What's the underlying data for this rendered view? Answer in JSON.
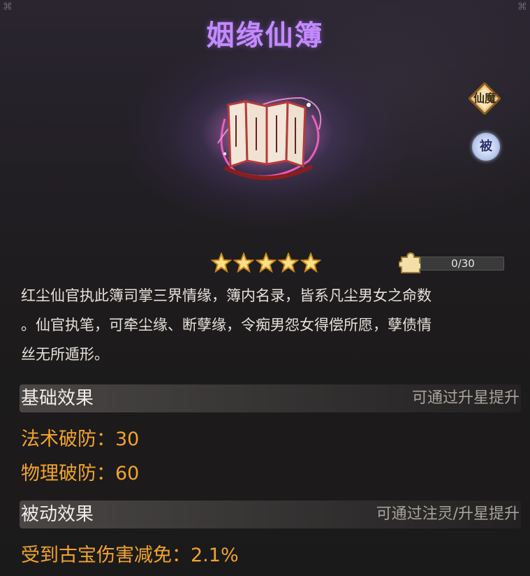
{
  "title": "姻缘仙簿",
  "badges": {
    "type_label": "仙魔",
    "passive_label": "被"
  },
  "stars": {
    "count": 5,
    "max": 5
  },
  "fragments": {
    "progress": "0/30",
    "current": 0,
    "total": 30
  },
  "description": {
    "line1": "红尘仙官执此簿司掌三界情缘，簿内名录，皆系凡尘男女之命数",
    "line2": "。仙官执笔，可牵尘缘、断孽缘，令痴男怨女得偿所愿，孽债情",
    "line3": "丝无所遁形。"
  },
  "basic": {
    "title": "基础效果",
    "hint": "可通过升星提升",
    "stats": [
      "法术破防：30",
      "物理破防：60"
    ]
  },
  "passive": {
    "title": "被动效果",
    "hint": "可通过注灵/升星提升",
    "stats": [
      "受到古宝伤害减免：2.1%"
    ]
  },
  "colors": {
    "title": "#c48aff",
    "stat": "#f0a42e",
    "text": "#e6e1da",
    "hint": "#a9a39c"
  }
}
